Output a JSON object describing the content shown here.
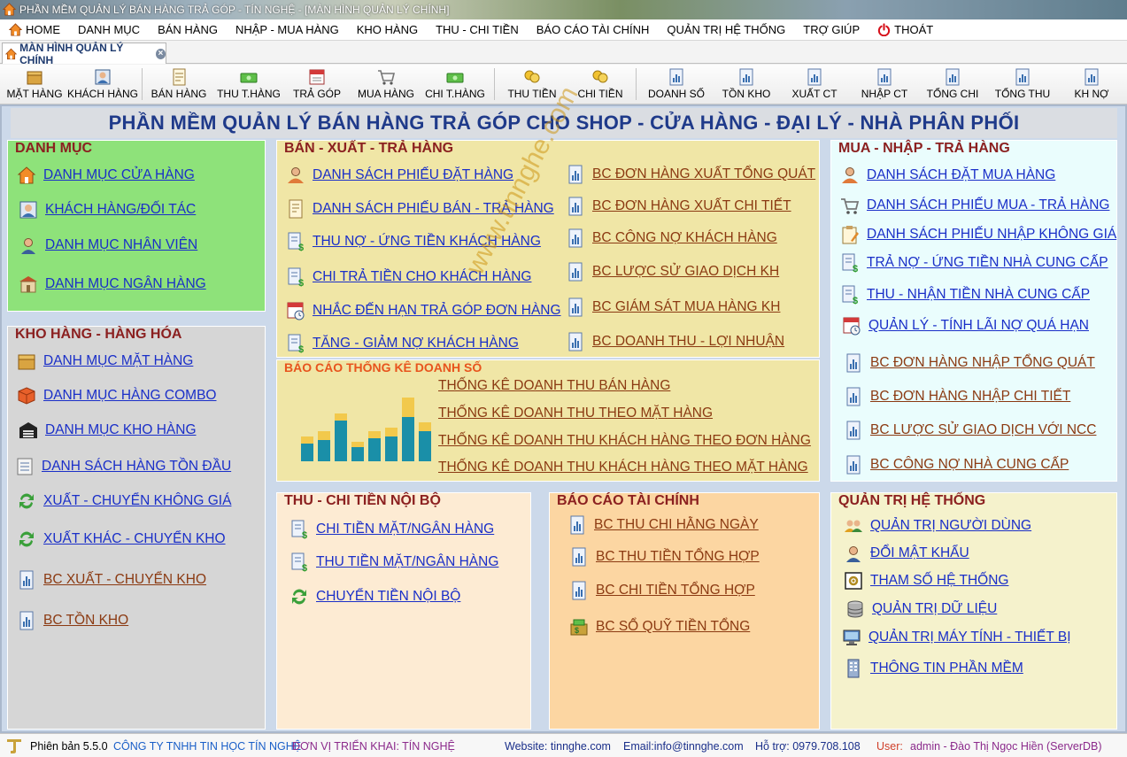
{
  "window": {
    "title": "PHẦN MỀM QUẢN LÝ BÁN HÀNG TRẢ GÓP - TÍN NGHỆ - [MÀN HÌNH QUẢN LÝ CHÍNH]"
  },
  "menu": {
    "items": [
      {
        "label": "HOME",
        "icon": "home-icon"
      },
      {
        "label": "DANH MỤC"
      },
      {
        "label": "BÁN HÀNG"
      },
      {
        "label": "NHẬP - MUA HÀNG"
      },
      {
        "label": "KHO HÀNG"
      },
      {
        "label": "THU - CHI TIỀN"
      },
      {
        "label": "BÁO CÁO TÀI CHÍNH"
      },
      {
        "label": "QUẢN TRỊ HỆ THỐNG"
      },
      {
        "label": "TRỢ GIÚP"
      },
      {
        "label": "THOÁT",
        "icon": "power-icon"
      }
    ]
  },
  "tab": {
    "label": "MÀN HÌNH QUẢN LÝ CHÍNH"
  },
  "toolbar": {
    "buttons": [
      {
        "label": "MẶT HÀNG",
        "icon": "box-icon"
      },
      {
        "label": "KHÁCH HÀNG",
        "icon": "person-card-icon"
      },
      {
        "label": "BÁN HÀNG",
        "icon": "document-icon"
      },
      {
        "label": "THU T.HÀNG",
        "icon": "money-icon"
      },
      {
        "label": "TRẢ GÓP",
        "icon": "calendar-icon"
      },
      {
        "label": "MUA HÀNG",
        "icon": "cart-icon"
      },
      {
        "label": "CHI T.HÀNG",
        "icon": "money-icon"
      },
      {
        "label": "THU TIỀN",
        "icon": "coins-hand-icon"
      },
      {
        "label": "CHI TIỀN",
        "icon": "coins-hand-icon"
      },
      {
        "label": "DOANH SỐ",
        "icon": "report-icon"
      },
      {
        "label": "TỒN KHO",
        "icon": "report-icon"
      },
      {
        "label": "XUẤT CT",
        "icon": "report-icon"
      },
      {
        "label": "NHẬP CT",
        "icon": "report-icon"
      },
      {
        "label": "TỔNG CHI",
        "icon": "report-icon"
      },
      {
        "label": "TỔNG THU",
        "icon": "report-icon"
      },
      {
        "label": "KH NỢ",
        "icon": "report-icon"
      }
    ]
  },
  "banner": "PHẦN MỀM QUẢN LÝ BÁN HÀNG TRẢ GÓP CHO SHOP - CỬA HÀNG - ĐẠI LÝ - NHÀ PHÂN PHỐI",
  "panels": {
    "danh_muc": {
      "title": "DANH MỤC",
      "items": [
        "DANH MỤC CỬA HÀNG",
        "KHÁCH HÀNG/ĐỐI TÁC",
        "DANH MỤC NHÂN VIÊN",
        "DANH MỤC NGÂN HÀNG"
      ]
    },
    "kho_hang": {
      "title": "KHO HÀNG - HÀNG HÓA",
      "items": [
        "DANH MỤC MẶT HÀNG",
        "DANH MỤC HÀNG COMBO",
        "DANH MỤC KHO HÀNG",
        "DANH SÁCH HÀNG TỒN ĐẦU",
        "XUẤT - CHUYỂN KHÔNG GIÁ",
        "XUẤT KHÁC - CHUYỂN KHO",
        "BC XUẤT - CHUYỂN KHO",
        "BC TỒN KHO"
      ]
    },
    "ban_xuat": {
      "title": "BÁN - XUẤT - TRẢ HÀNG",
      "left_items": [
        "DANH SÁCH PHIẾU ĐẶT HÀNG",
        "DANH SÁCH PHIẾU BÁN - TRẢ HÀNG",
        "THU NỢ - ỨNG TIỀN KHÁCH HÀNG",
        "CHI TRẢ TIỀN CHO KHÁCH HÀNG",
        "NHẮC ĐẾN HẠN TRẢ GÓP ĐƠN HÀNG",
        "TĂNG - GIẢM NỢ KHÁCH HÀNG"
      ],
      "right_items": [
        "BC ĐƠN HÀNG XUẤT TỔNG QUÁT",
        "BC ĐƠN HÀNG XUẤT CHI TIẾT",
        "BC CÔNG NỢ KHÁCH HÀNG",
        "BC LƯỢC SỬ GIAO DỊCH KH",
        "BC GIÁM SÁT MUA HÀNG KH",
        "BC DOANH THU - LỢI NHUẬN"
      ]
    },
    "bao_cao_thong_ke": {
      "title": "BÁO CÁO THỐNG KÊ DOANH SỐ",
      "items": [
        "THỐNG KÊ DOANH THU BÁN HÀNG",
        "THỐNG KÊ DOANH THU THEO MẶT HÀNG",
        "THỐNG KÊ DOANH THU KHÁCH HÀNG THEO ĐƠN HÀNG",
        "THỐNG KÊ DOANH THU KHÁCH HÀNG THEO MẶT HÀNG"
      ]
    },
    "mua_nhap": {
      "title": "MUA - NHẬP - TRẢ HÀNG",
      "items": [
        "DANH SÁCH ĐẶT MUA HÀNG",
        "DANH SÁCH PHIẾU MUA - TRẢ HÀNG",
        "DANH SÁCH PHIẾU NHẬP KHÔNG GIÁ",
        "TRẢ NỢ - ỨNG TIỀN NHÀ CUNG CẤP",
        "THU - NHẬN TIỀN NHÀ CUNG CẤP",
        "QUẢN LÝ - TÍNH LÃI  NỢ QUÁ HẠN"
      ],
      "report_items": [
        "BC ĐƠN HÀNG NHẬP TỔNG QUÁT",
        "BC ĐƠN HÀNG NHẬP CHI TIẾT",
        "BC LƯỢC SỬ GIAO DỊCH VỚI NCC",
        "BC CÔNG NỢ NHÀ CUNG CẤP"
      ]
    },
    "thu_chi": {
      "title": "THU - CHI TIỀN NỘI BỘ",
      "items": [
        "CHI TIỀN MẶT/NGÂN HÀNG",
        "THU TIỀN MẶT/NGÂN HÀNG",
        "CHUYỂN TIỀN NỘI BỘ"
      ]
    },
    "bao_cao_tai_chinh": {
      "title": "BÁO CÁO TÀI CHÍNH",
      "items": [
        "BC THU CHI HẰNG NGÀY",
        "BC THU TIỀN TỔNG HỢP",
        "BC CHI TIỀN TỔNG HỢP",
        "BC SỔ QUỸ TIỀN TỔNG"
      ]
    },
    "quan_tri": {
      "title": "QUẢN TRỊ HỆ THỐNG",
      "items": [
        "QUẢN TRỊ NGƯỜI DÙNG",
        "ĐỔI MẬT KHẨU",
        "THAM SỐ HỆ THỐNG",
        "QUẢN TRỊ DỮ LIỆU",
        "QUẢN TRỊ MÁY TÍNH - THIẾT BỊ",
        "THÔNG TIN PHẦN MỀM"
      ]
    }
  },
  "watermark": "www.tinnghe.com",
  "footer": {
    "version": "Phiên bản 5.5.0",
    "company": "CÔNG TY TNHH TIN HỌC TÍN NGHỆ",
    "deploy": "ĐƠN VỊ TRIỂN KHAI: TÍN NGHỆ",
    "website": "Website: tinnghe.com",
    "email": "Email:info@tinnghe.com",
    "support": "Hỗ trợ: 0979.708.108",
    "user_label": "User:",
    "user_value": "admin - Đào Thị Ngọc Hiền (ServerDB)"
  },
  "colors": {
    "danh_muc_bg": "#8ee27a",
    "kho_bg": "#d6d6d6",
    "ban_bg": "#f0e6a6",
    "mua_bg": "#eafdfd",
    "thu_chi_bg": "#fdebd3",
    "bctc_bg": "#fcd6a2",
    "quan_tri_bg": "#f5f2cc",
    "banner_text": "#1f3a8a",
    "panel_title": "#8b2020",
    "link_blue": "#1a2fc8",
    "link_brown": "#8b3a12"
  }
}
